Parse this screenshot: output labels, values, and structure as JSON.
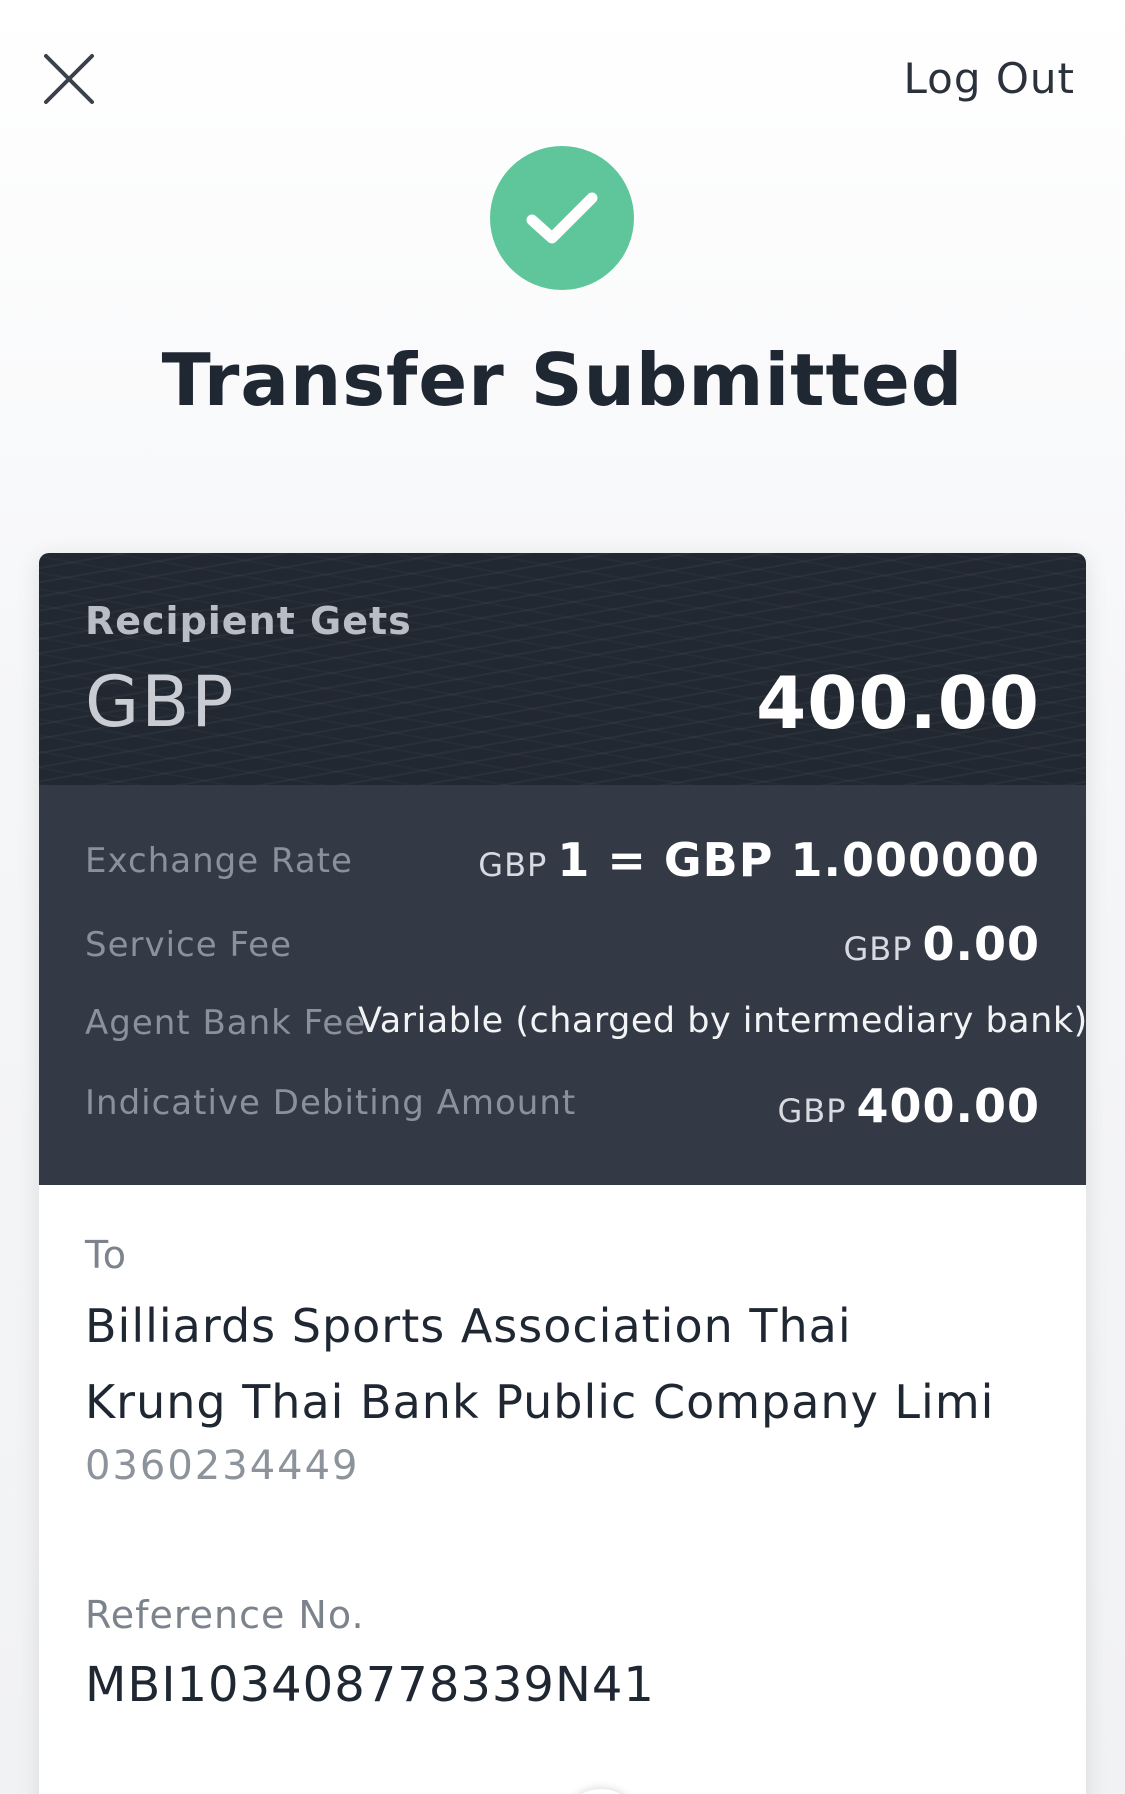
{
  "header": {
    "logout_label": "Log Out"
  },
  "status": {
    "title": "Transfer Submitted",
    "icon": "check-circle-icon",
    "icon_color": "#5ec69a"
  },
  "recipient": {
    "label": "Recipient Gets",
    "currency": "GBP",
    "amount": "400.00"
  },
  "details": {
    "exchange_rate": {
      "label": "Exchange Rate",
      "from_currency": "GBP",
      "value": "1 = GBP 1.000000"
    },
    "service_fee": {
      "label": "Service Fee",
      "currency": "GBP",
      "value": "0.00"
    },
    "agent_bank_fee": {
      "label": "Agent Bank Fee",
      "value": "Variable (charged by intermediary bank)"
    },
    "debiting_amount": {
      "label": "Indicative Debiting Amount",
      "currency": "GBP",
      "value": "400.00"
    }
  },
  "to": {
    "label": "To",
    "name": "Billiards Sports Association Thai",
    "bank": "Krung Thai Bank Public Company Limi",
    "account": "0360234449"
  },
  "reference": {
    "label": "Reference No.",
    "value": "MBI103408778339N41"
  },
  "colors": {
    "card_header": "#222831",
    "details_bg": "#333a45",
    "success": "#5ec69a"
  }
}
